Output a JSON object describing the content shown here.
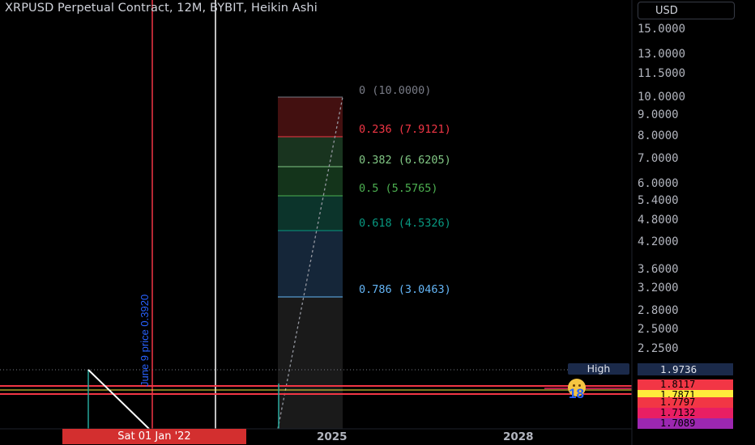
{
  "chart_header": {
    "title": "XRPUSD Perpetual Contract, 12M, BYBIT, Heikin Ashi",
    "currency": "USD"
  },
  "price_axis": {
    "ticks": [
      "15.0000",
      "13.0000",
      "11.5000",
      "10.0000",
      "9.0000",
      "8.0000",
      "7.0000",
      "6.0000",
      "5.4000",
      "4.8000",
      "4.2000",
      "3.6000",
      "3.2000",
      "2.8000",
      "2.5000",
      "2.2500"
    ],
    "scale": "log"
  },
  "fib_levels": [
    {
      "label": "0 (10.0000)",
      "color": "#787b86"
    },
    {
      "label": "0.236 (7.9121)",
      "color": "#f23645"
    },
    {
      "label": "0.382 (6.6205)",
      "color": "#81c784"
    },
    {
      "label": "0.5 (5.5765)",
      "color": "#4caf50"
    },
    {
      "label": "0.618 (4.5326)",
      "color": "#089981"
    },
    {
      "label": "0.786 (3.0463)",
      "color": "#64b5f6"
    }
  ],
  "price_labels": {
    "high_tag": "High",
    "high_value": "1.9736",
    "values": [
      {
        "value": "1.8117",
        "bg": "#f23645"
      },
      {
        "value": "1.7871",
        "bg": "#ffeb3b"
      },
      {
        "value": "1.7797",
        "bg": "#f23645"
      },
      {
        "value": "1.7132",
        "bg": "#e91e63"
      },
      {
        "value": "1.7089",
        "bg": "#9c27b0"
      }
    ]
  },
  "time_axis": {
    "cursor_label": "Sat 01 Jan '22",
    "ticks": [
      "2025",
      "2028"
    ]
  },
  "annotations": {
    "vertical_note": "June 9 price 0.3920",
    "counter": "18"
  },
  "colors": {
    "background": "#000000",
    "red_line": "#f23645",
    "white_line": "#ffffff",
    "price_line_yellow": "#ffeb3b"
  }
}
